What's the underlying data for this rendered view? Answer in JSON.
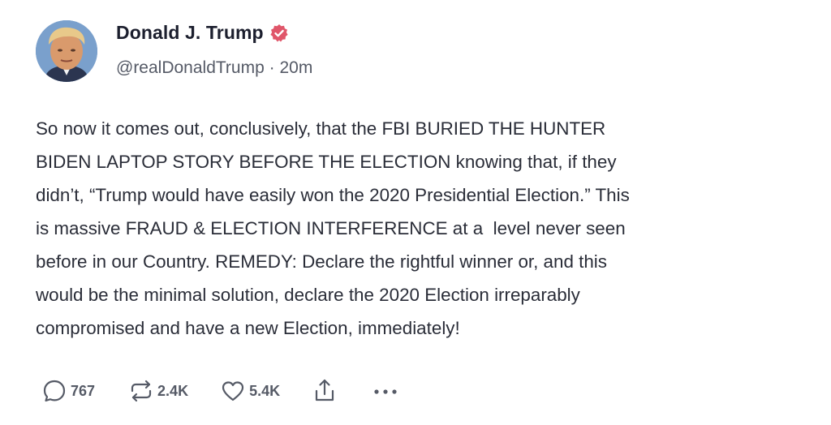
{
  "author": {
    "name": "Donald J. Trump",
    "handle": "@realDonaldTrump",
    "separator": "·",
    "time": "20m",
    "verified_color": "#e0566a"
  },
  "post": {
    "lines": [
      "So now it comes out, conclusively, that the FBI BURIED THE HUNTER",
      "BIDEN LAPTOP STORY BEFORE THE ELECTION knowing that, if they",
      "didn’t, “Trump would have easily won the 2020 Presidential Election.” This",
      "is massive FRAUD & ELECTION INTERFERENCE at a  level never seen",
      "before in our Country. REMEDY: Declare the rightful winner or, and this",
      "would be the minimal solution, declare the 2020 Election irreparably",
      "compromised and have a new Election, immediately!"
    ]
  },
  "actions": {
    "replies": "767",
    "reposts": "2.4K",
    "likes": "5.4K",
    "reply_icon": "reply-bubble-icon",
    "repost_icon": "repost-arrows-icon",
    "like_icon": "heart-icon",
    "share_icon": "share-upload-icon",
    "more_icon": "more-dots-icon"
  }
}
